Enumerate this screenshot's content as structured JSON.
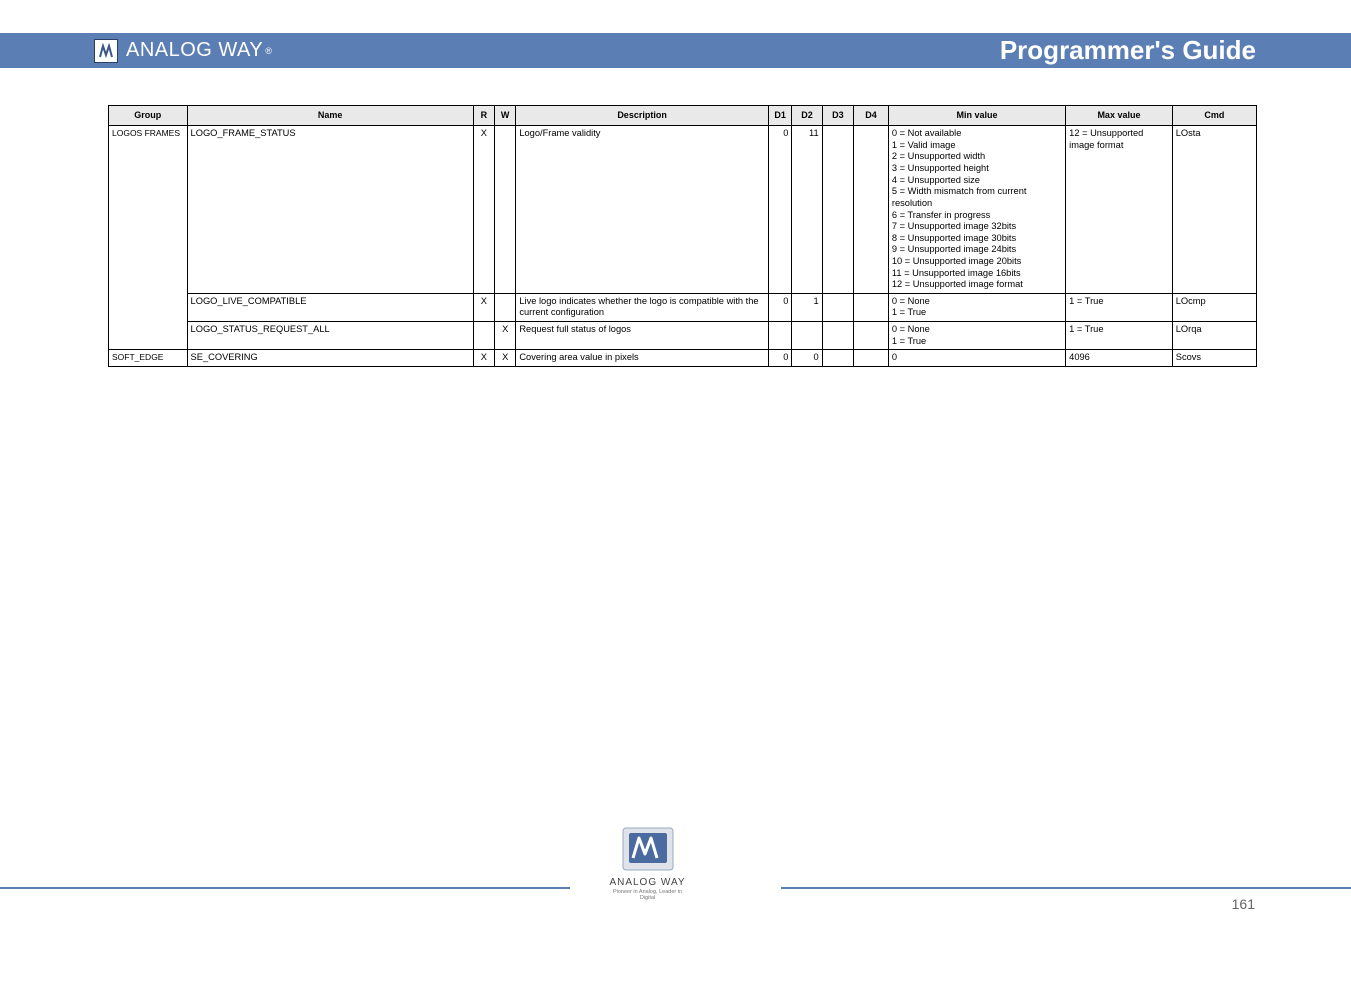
{
  "brand": {
    "name": "ANALOG WAY",
    "reg": "®",
    "tagline": "Pioneer in Analog, Leader in Digital"
  },
  "header": {
    "title": "Programmer's Guide"
  },
  "page_number": "161",
  "table": {
    "headers": {
      "group": "Group",
      "name": "Name",
      "r": "R",
      "w": "W",
      "desc": "Description",
      "d1": "D1",
      "d2": "D2",
      "d3": "D3",
      "d4": "D4",
      "min": "Min value",
      "max": "Max value",
      "cmd": "Cmd"
    },
    "rows": [
      {
        "group": "LOGOS FRAMES",
        "name": "LOGO_FRAME_STATUS",
        "r": "X",
        "w": "",
        "desc": "Logo/Frame validity",
        "d1": "0",
        "d2": "11",
        "d3": "",
        "d4": "",
        "min": "0 = Not available\n1 = Valid image\n2 = Unsupported width\n3 = Unsupported height\n4 = Unsupported size\n5 = Width mismatch from current resolution\n6 = Transfer in progress\n7 = Unsupported image 32bits\n8 = Unsupported image 30bits\n9 = Unsupported image 24bits\n10 = Unsupported image 20bits\n11 = Unsupported image 16bits\n12 = Unsupported image format ",
        "max": "12 = Unsupported image format",
        "cmd": "LOsta"
      },
      {
        "group": "",
        "name": "LOGO_LIVE_COMPATIBLE",
        "r": "X",
        "w": "",
        "desc": "Live logo indicates whether the logo is compatible with the current configuration",
        "d1": "0",
        "d2": "1",
        "d3": "",
        "d4": "",
        "min": "0 = None\n1 = True",
        "max": "1 = True",
        "cmd": "LOcmp"
      },
      {
        "group": "",
        "name": "LOGO_STATUS_REQUEST_ALL",
        "r": "",
        "w": "X",
        "desc": "Request full status of logos",
        "d1": "",
        "d2": "",
        "d3": "",
        "d4": "",
        "min": "0 = None\n1 = True",
        "max": "1 = True",
        "cmd": "LOrqa"
      },
      {
        "group": "SOFT_EDGE",
        "name": "SE_COVERING",
        "r": "X",
        "w": "X",
        "desc": "Covering area value in pixels",
        "d1": "0",
        "d2": "0",
        "d3": "",
        "d4": "",
        "min": "0",
        "max": "4096",
        "cmd": "Scovs"
      }
    ]
  }
}
